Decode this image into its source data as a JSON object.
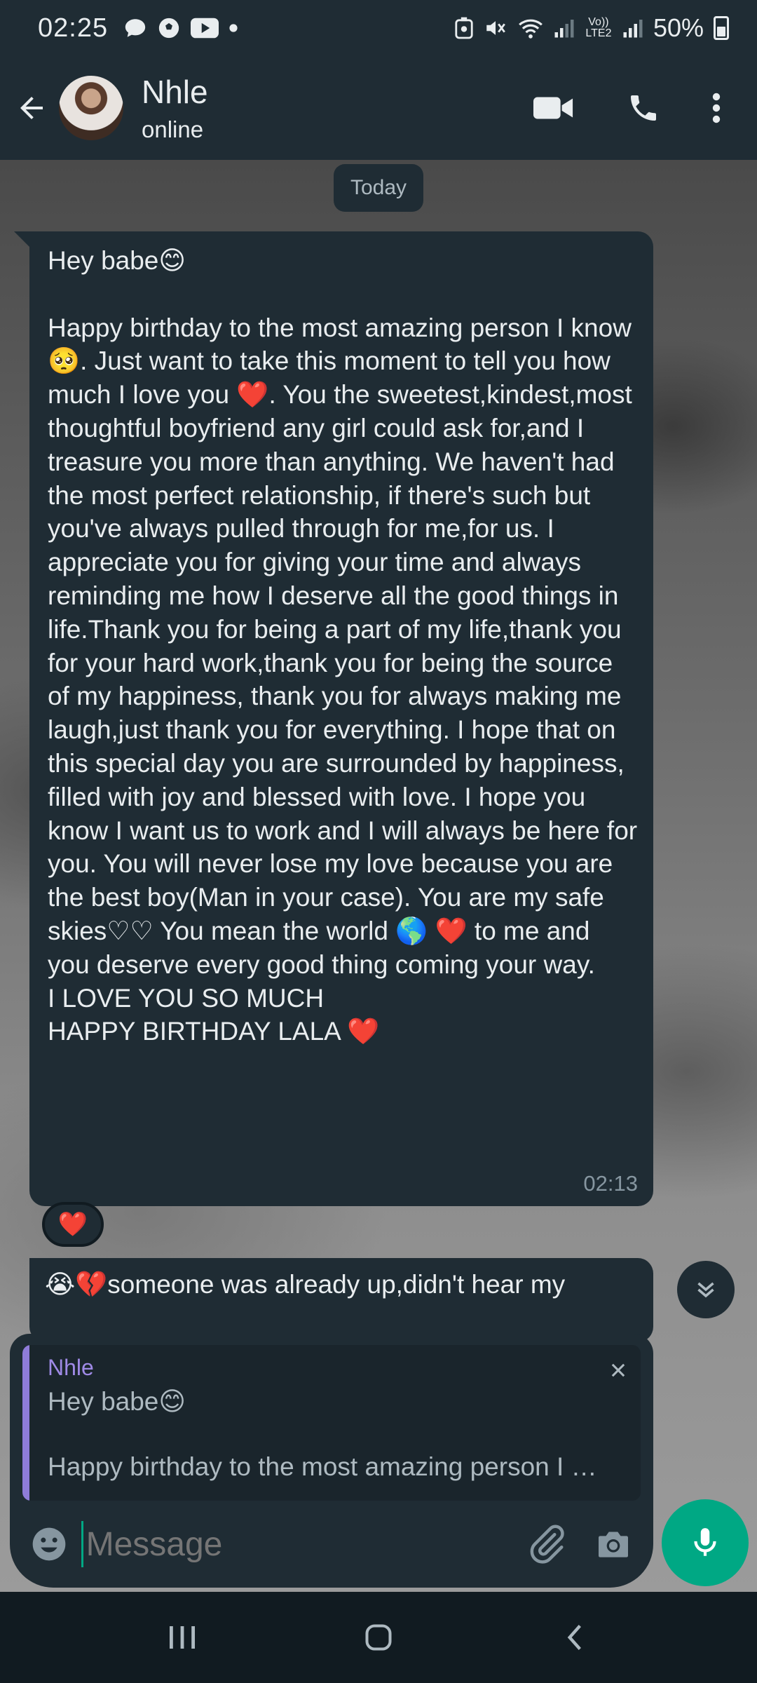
{
  "status_bar": {
    "time": "02:25",
    "battery": "50%",
    "left_icons": [
      "chat-icon",
      "soccer-icon",
      "youtube-icon",
      "dot-icon"
    ],
    "right_icons": [
      "recycle-icon",
      "mute-icon",
      "wifi-icon",
      "signal-icon",
      "volte-icon",
      "signal-icon",
      "battery-icon"
    ],
    "volte_label": "Vo)) LTE2"
  },
  "header": {
    "contact_name": "Nhle",
    "contact_status": "online"
  },
  "chat": {
    "date_chip": "Today",
    "messages": [
      {
        "text": "Hey babe😊\n\nHappy birthday to the most amazing person I know🥺. Just want to take this moment to tell you how much I love you ❤️. You the sweetest,kindest,most thoughtful boyfriend any girl could ask for,and I treasure you more than anything. We haven't had the most perfect relationship, if there's such but you've always pulled through for me,for us. I appreciate you for giving your time and always reminding me how I deserve all the good things in life.Thank you for being a part of my life,thank you for your hard work,thank you for being the source of my happiness, thank you for always making me laugh,just thank you for everything. I hope that on this special day you are surrounded by happiness, filled with joy and blessed with love. I hope you know I want us to work and I will always be here for you. You will never lose my love because you are the best boy(Man in your case). You are my safe skies♡♡ You mean the world 🌎 ❤️ to me and you deserve every good thing coming your way.\nI LOVE YOU SO MUCH\nHAPPY BIRTHDAY LALA ❤️",
        "time": "02:13",
        "reaction": "❤️"
      },
      {
        "text": "😭💔someone was already up,didn't hear my"
      }
    ]
  },
  "composer": {
    "reply": {
      "name": "Nhle",
      "line1": "Hey babe😊",
      "line2": "Happy birthday to the most amazing person I know🥺. Just want to take this moment"
    },
    "placeholder": "Message"
  },
  "colors": {
    "accent": "#00a884",
    "bubble": "#1f2c34",
    "header": "#1f2c34",
    "reply_bar": "#8f7cd9"
  }
}
